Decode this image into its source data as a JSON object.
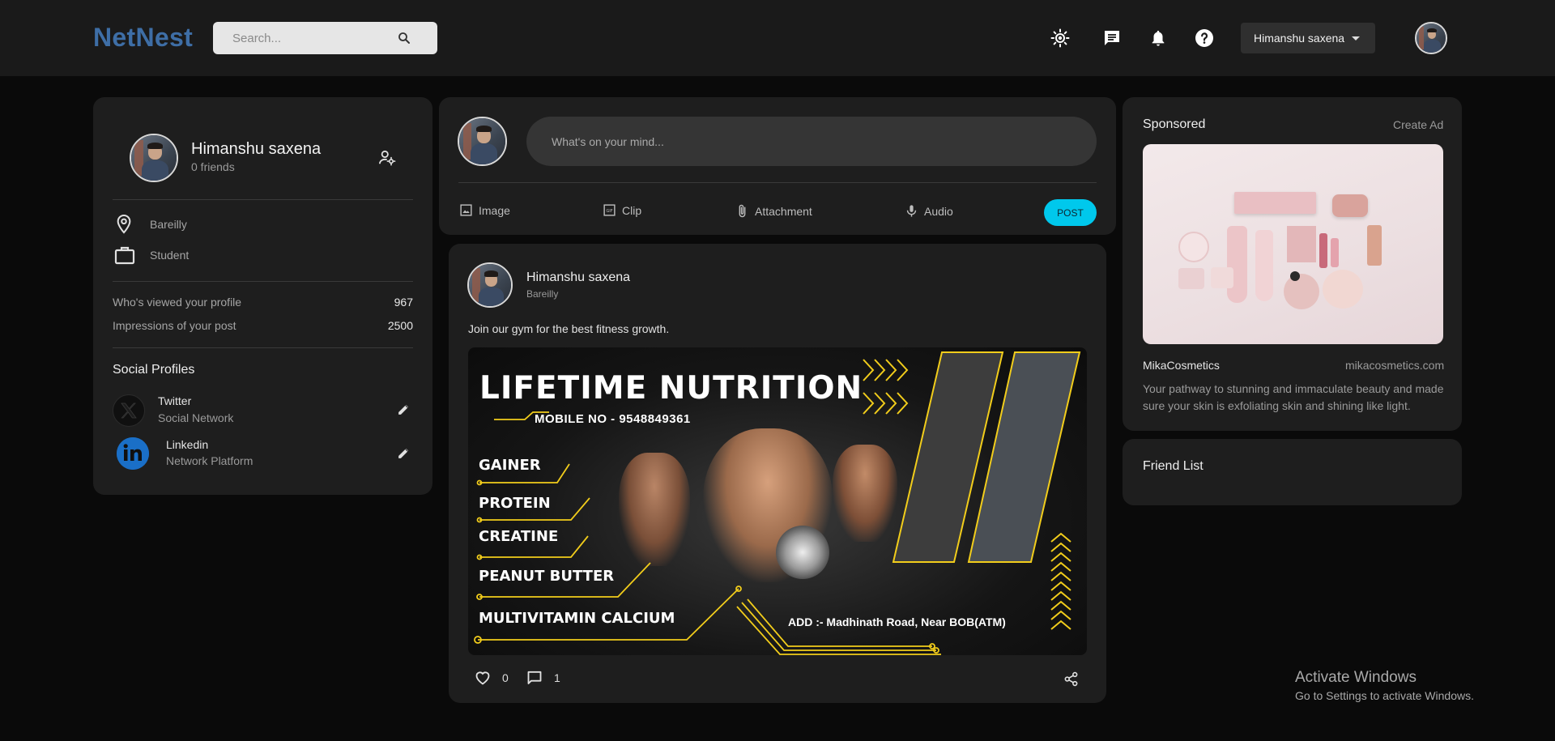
{
  "header": {
    "logo": "NetNest",
    "search_placeholder": "Search...",
    "icons": [
      "sun-icon",
      "chat-icon",
      "bell-icon",
      "help-icon"
    ],
    "user_menu_label": "Himanshu saxena"
  },
  "profile": {
    "name": "Himanshu saxena",
    "friends": "0 friends",
    "location": "Bareilly",
    "occupation": "Student",
    "stats": [
      {
        "label": "Who's viewed your profile",
        "value": "967"
      },
      {
        "label": "Impressions of your post",
        "value": "2500"
      }
    ],
    "social_title": "Social Profiles",
    "socials": [
      {
        "name": "Twitter",
        "sub": "Social Network"
      },
      {
        "name": "Linkedin",
        "sub": "Network Platform"
      }
    ]
  },
  "composer": {
    "placeholder": "What's on your mind...",
    "actions": [
      "Image",
      "Clip",
      "Attachment",
      "Audio"
    ],
    "post_label": "POST"
  },
  "post": {
    "author": "Himanshu saxena",
    "location": "Bareilly",
    "text": "Join our gym for the best fitness growth.",
    "banner": {
      "title": "LIFETIME NUTRITION",
      "mobile": "MOBILE NO - 9548849361",
      "items": [
        "GAINER",
        "PROTEIN",
        "CREATINE",
        "PEANUT BUTTER",
        "MULTIVITAMIN CALCIUM"
      ],
      "address": "ADD :- Madhinath Road, Near BOB(ATM)"
    },
    "likes": "0",
    "comments": "1"
  },
  "sponsored": {
    "title": "Sponsored",
    "create_ad": "Create Ad",
    "brand": "MikaCosmetics",
    "url": "mikacosmetics.com",
    "description": "Your pathway to stunning and immaculate beauty and made sure your skin is exfoliating skin and shining like light."
  },
  "friend_list": {
    "title": "Friend List"
  },
  "watermark": {
    "line1": "Activate Windows",
    "line2": "Go to Settings to activate Windows."
  },
  "colors": {
    "accent": "#00c8ec",
    "logo": "#3e6ea6",
    "banner_yellow": "#f2cd1b"
  }
}
